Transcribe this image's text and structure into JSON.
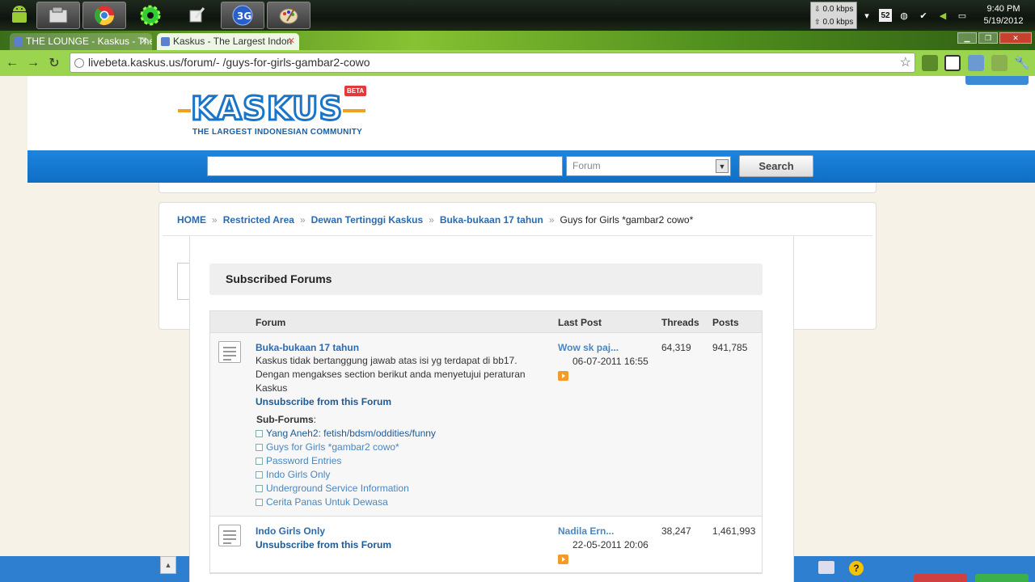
{
  "taskbar": {
    "net_down": "0.0 kbps",
    "net_up": "0.0 kbps",
    "tray_badge": "52",
    "clock_time": "9:40 PM",
    "clock_date": "5/19/2012"
  },
  "browser": {
    "tabs": [
      {
        "label": "THE LOUNGE - Kaskus - The"
      },
      {
        "label": "Kaskus - The Largest Indon"
      }
    ],
    "url": "livebeta.kaskus.us/forum/- /guys-for-girls-gambar2-cowo"
  },
  "site": {
    "logo_text": "KASKUS",
    "logo_badge": "BETA",
    "logo_tagline": "THE LARGEST INDONESIAN COMMUNITY"
  },
  "search": {
    "query": "",
    "scope_selected": "Forum",
    "button_label": "Search"
  },
  "breadcrumb": {
    "items": [
      "HOME",
      "Restricted Area",
      "Dewan Tertinggi Kaskus",
      "Buka-bukaan 17 tahun"
    ],
    "separator": "»",
    "current": "Guys for Girls *gambar2 cowo*"
  },
  "subscribed": {
    "heading": "Subscribed Forums",
    "columns": {
      "forum": "Forum",
      "last_post": "Last Post",
      "threads": "Threads",
      "posts": "Posts"
    },
    "rows": [
      {
        "title": "Buka-bukaan 17 tahun",
        "description": "Kaskus tidak bertanggung jawab atas isi yg terdapat di bb17. Dengan mengakses section berikut anda menyetujui peraturan Kaskus",
        "unsubscribe": "Unsubscribe from this Forum",
        "subforums_label": "Sub-Forums",
        "subforums_colon": ":",
        "subforums": [
          "Yang Aneh2: fetish/bdsm/oddities/funny",
          "Guys for Girls *gambar2 cowo*",
          "Password Entries",
          "Indo Girls Only",
          "Underground Service Information",
          "Cerita Panas Untuk Dewasa"
        ],
        "last_post_title": "Wow sk paj...",
        "last_post_date": "06-07-2011 16:55",
        "threads": "64,319",
        "posts": "941,785"
      },
      {
        "title": "Indo Girls Only",
        "unsubscribe": "Unsubscribe from this Forum",
        "last_post_title": "Nadila Ern...",
        "last_post_date": "22-05-2011 20:06",
        "threads": "38,247",
        "posts": "1,461,993"
      }
    ]
  }
}
